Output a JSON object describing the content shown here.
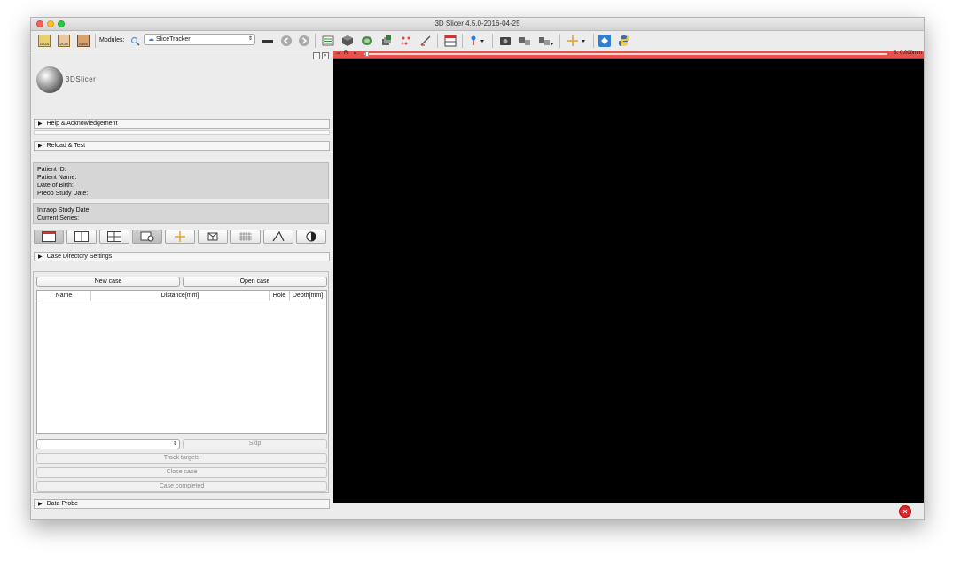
{
  "window": {
    "title": "3D Slicer 4.5.0-2016-04-25"
  },
  "toolbar": {
    "data_label": "DATA",
    "dcm_label": "DCM",
    "save_label": "SAVE",
    "modules_label": "Modules:",
    "module_selected": "SliceTracker"
  },
  "panel": {
    "logo_text": "3DSlicer",
    "help_section": "Help & Acknowledgement",
    "reload_section": "Reload & Test",
    "patient": {
      "id_label": "Patient ID:",
      "name_label": "Patient Name:",
      "dob_label": "Date of Birth:",
      "preop_label": "Preop Study Date:"
    },
    "study": {
      "intraop_label": "Intraop Study Date:",
      "series_label": "Current Series:"
    },
    "case_dir_section": "Case Directory Settings",
    "buttons": {
      "new_case": "New case",
      "open_case": "Open case",
      "skip": "Skip",
      "track_targets": "Track targets",
      "close_case": "Close case",
      "case_completed": "Case completed"
    },
    "table_headers": [
      "Name",
      "Distance[mm]",
      "Hole",
      "Depth[mm]"
    ],
    "data_probe_section": "Data Probe"
  },
  "view": {
    "orientation_label": "R",
    "slice_offset": "S: 0.000mm",
    "bar_color": "#e9524a"
  },
  "colors": {
    "error": "#e0262b",
    "python": "#3b6ea5",
    "accent_blue": "#2d7fd3"
  }
}
